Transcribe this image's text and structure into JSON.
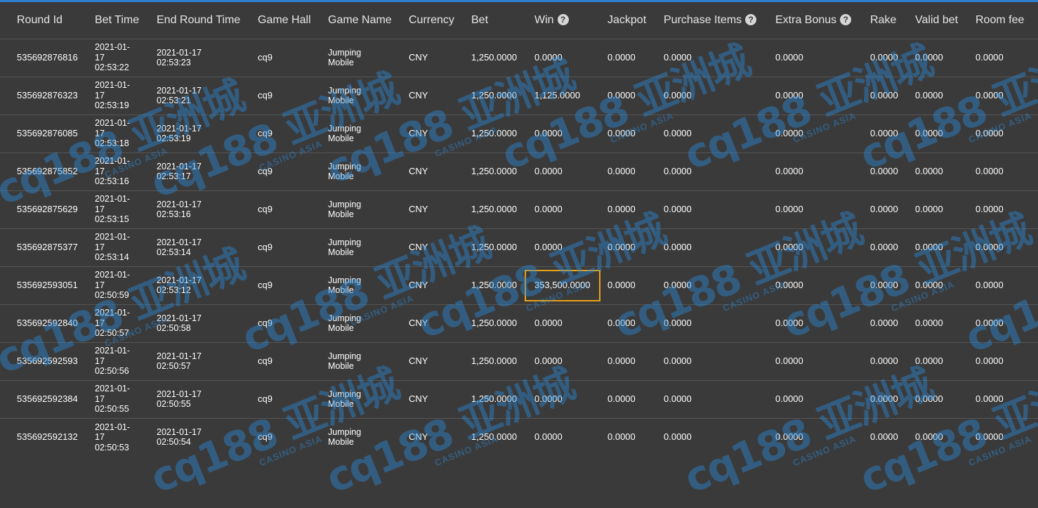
{
  "columns": [
    {
      "key": "round_id",
      "label": "Round Id",
      "help": false
    },
    {
      "key": "bet_time",
      "label": "Bet Time",
      "help": false
    },
    {
      "key": "end_time",
      "label": "End Round Time",
      "help": false
    },
    {
      "key": "game_hall",
      "label": "Game Hall",
      "help": false
    },
    {
      "key": "game_name",
      "label": "Game Name",
      "help": false
    },
    {
      "key": "currency",
      "label": "Currency",
      "help": false
    },
    {
      "key": "bet",
      "label": "Bet",
      "help": false
    },
    {
      "key": "win",
      "label": "Win",
      "help": true
    },
    {
      "key": "jackpot",
      "label": "Jackpot",
      "help": false
    },
    {
      "key": "purchase_items",
      "label": "Purchase Items",
      "help": true
    },
    {
      "key": "extra_bonus",
      "label": "Extra Bonus",
      "help": true
    },
    {
      "key": "rake",
      "label": "Rake",
      "help": false
    },
    {
      "key": "valid_bet",
      "label": "Valid bet",
      "help": false
    },
    {
      "key": "room_fee",
      "label": "Room fee",
      "help": false
    }
  ],
  "help_glyph": "?",
  "highlight_color": "#e8a317",
  "accent_color": "#2f7fd1",
  "watermark": {
    "logo": "cq188 亚洲城",
    "sub": "CASINO ASIA"
  },
  "rows": [
    {
      "round_id": "535692876816",
      "bet_time": "2021-01-\n17\n02:53:22",
      "end_time": "2021-01-17\n02:53:23",
      "game_hall": "cq9",
      "game_name": "Jumping\nMobile",
      "currency": "CNY",
      "bet": "1,250.0000",
      "win": "0.0000",
      "jackpot": "0.0000",
      "purchase_items": "0.0000",
      "extra_bonus": "0.0000",
      "rake": "0.0000",
      "valid_bet": "0.0000",
      "room_fee": "0.0000",
      "highlight": false
    },
    {
      "round_id": "535692876323",
      "bet_time": "2021-01-\n17\n02:53:19",
      "end_time": "2021-01-17\n02:53:21",
      "game_hall": "cq9",
      "game_name": "Jumping\nMobile",
      "currency": "CNY",
      "bet": "1,250.0000",
      "win": "1,125.0000",
      "jackpot": "0.0000",
      "purchase_items": "0.0000",
      "extra_bonus": "0.0000",
      "rake": "0.0000",
      "valid_bet": "0.0000",
      "room_fee": "0.0000",
      "highlight": false
    },
    {
      "round_id": "535692876085",
      "bet_time": "2021-01-\n17\n02:53:18",
      "end_time": "2021-01-17\n02:53:19",
      "game_hall": "cq9",
      "game_name": "Jumping\nMobile",
      "currency": "CNY",
      "bet": "1,250.0000",
      "win": "0.0000",
      "jackpot": "0.0000",
      "purchase_items": "0.0000",
      "extra_bonus": "0.0000",
      "rake": "0.0000",
      "valid_bet": "0.0000",
      "room_fee": "0.0000",
      "highlight": false
    },
    {
      "round_id": "535692875852",
      "bet_time": "2021-01-\n17\n02:53:16",
      "end_time": "2021-01-17\n02:53:17",
      "game_hall": "cq9",
      "game_name": "Jumping\nMobile",
      "currency": "CNY",
      "bet": "1,250.0000",
      "win": "0.0000",
      "jackpot": "0.0000",
      "purchase_items": "0.0000",
      "extra_bonus": "0.0000",
      "rake": "0.0000",
      "valid_bet": "0.0000",
      "room_fee": "0.0000",
      "highlight": false
    },
    {
      "round_id": "535692875629",
      "bet_time": "2021-01-\n17\n02:53:15",
      "end_time": "2021-01-17\n02:53:16",
      "game_hall": "cq9",
      "game_name": "Jumping\nMobile",
      "currency": "CNY",
      "bet": "1,250.0000",
      "win": "0.0000",
      "jackpot": "0.0000",
      "purchase_items": "0.0000",
      "extra_bonus": "0.0000",
      "rake": "0.0000",
      "valid_bet": "0.0000",
      "room_fee": "0.0000",
      "highlight": false
    },
    {
      "round_id": "535692875377",
      "bet_time": "2021-01-\n17\n02:53:14",
      "end_time": "2021-01-17\n02:53:14",
      "game_hall": "cq9",
      "game_name": "Jumping\nMobile",
      "currency": "CNY",
      "bet": "1,250.0000",
      "win": "0.0000",
      "jackpot": "0.0000",
      "purchase_items": "0.0000",
      "extra_bonus": "0.0000",
      "rake": "0.0000",
      "valid_bet": "0.0000",
      "room_fee": "0.0000",
      "highlight": false
    },
    {
      "round_id": "535692593051",
      "bet_time": "2021-01-\n17\n02:50:59",
      "end_time": "2021-01-17\n02:53:12",
      "game_hall": "cq9",
      "game_name": "Jumping\nMobile",
      "currency": "CNY",
      "bet": "1,250.0000",
      "win": "353,500.0000",
      "jackpot": "0.0000",
      "purchase_items": "0.0000",
      "extra_bonus": "0.0000",
      "rake": "0.0000",
      "valid_bet": "0.0000",
      "room_fee": "0.0000",
      "highlight": true
    },
    {
      "round_id": "535692592840",
      "bet_time": "2021-01-\n17\n02:50:57",
      "end_time": "2021-01-17\n02:50:58",
      "game_hall": "cq9",
      "game_name": "Jumping\nMobile",
      "currency": "CNY",
      "bet": "1,250.0000",
      "win": "0.0000",
      "jackpot": "0.0000",
      "purchase_items": "0.0000",
      "extra_bonus": "0.0000",
      "rake": "0.0000",
      "valid_bet": "0.0000",
      "room_fee": "0.0000",
      "highlight": false
    },
    {
      "round_id": "535692592593",
      "bet_time": "2021-01-\n17\n02:50:56",
      "end_time": "2021-01-17\n02:50:57",
      "game_hall": "cq9",
      "game_name": "Jumping\nMobile",
      "currency": "CNY",
      "bet": "1,250.0000",
      "win": "0.0000",
      "jackpot": "0.0000",
      "purchase_items": "0.0000",
      "extra_bonus": "0.0000",
      "rake": "0.0000",
      "valid_bet": "0.0000",
      "room_fee": "0.0000",
      "highlight": false
    },
    {
      "round_id": "535692592384",
      "bet_time": "2021-01-\n17\n02:50:55",
      "end_time": "2021-01-17\n02:50:55",
      "game_hall": "cq9",
      "game_name": "Jumping\nMobile",
      "currency": "CNY",
      "bet": "1,250.0000",
      "win": "0.0000",
      "jackpot": "0.0000",
      "purchase_items": "0.0000",
      "extra_bonus": "0.0000",
      "rake": "0.0000",
      "valid_bet": "0.0000",
      "room_fee": "0.0000",
      "highlight": false
    },
    {
      "round_id": "535692592132",
      "bet_time": "2021-01-\n17\n02:50:53",
      "end_time": "2021-01-17\n02:50:54",
      "game_hall": "cq9",
      "game_name": "Jumping\nMobile",
      "currency": "CNY",
      "bet": "1,250.0000",
      "win": "0.0000",
      "jackpot": "0.0000",
      "purchase_items": "0.0000",
      "extra_bonus": "0.0000",
      "rake": "0.0000",
      "valid_bet": "0.0000",
      "room_fee": "0.0000",
      "highlight": false
    }
  ]
}
